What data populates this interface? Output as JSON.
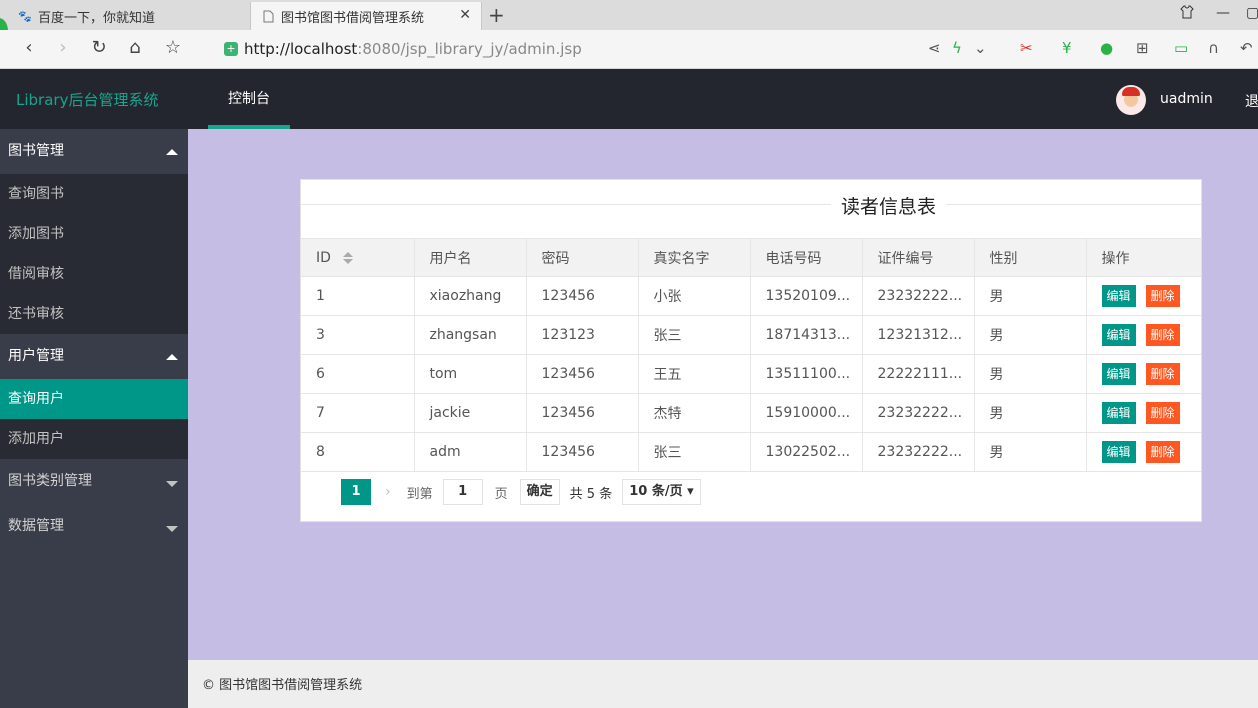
{
  "browser": {
    "tabs": [
      {
        "title": "百度一下，你就知道",
        "icon": "baidu-paw-icon"
      },
      {
        "title": "图书馆图书借阅管理系统",
        "icon": "page-icon"
      }
    ],
    "url_host": "http://localhost",
    "url_rest": ":8080/jsp_library_jy/admin.jsp"
  },
  "header": {
    "logo": "Library后台管理系统",
    "nav_console": "控制台",
    "username": "uadmin",
    "logout": "退"
  },
  "sidebar": {
    "book_group": "图书管理",
    "book_items": [
      "查询图书",
      "添加图书",
      "借阅审核",
      "还书审核"
    ],
    "user_group": "用户管理",
    "user_items": [
      "查询用户",
      "添加用户"
    ],
    "category_group": "图书类别管理",
    "data_group": "数据管理"
  },
  "panel": {
    "title": "读者信息表",
    "columns": [
      "ID",
      "用户名",
      "密码",
      "真实名字",
      "电话号码",
      "证件编号",
      "性别",
      "操作"
    ],
    "edit_label": "编辑",
    "delete_label": "删除",
    "rows": [
      [
        "1",
        "xiaozhang",
        "123456",
        "小张",
        "13520109...",
        "23232222...",
        "男"
      ],
      [
        "3",
        "zhangsan",
        "123123",
        "张三",
        "18714313...",
        "12321312...",
        "男"
      ],
      [
        "6",
        "tom",
        "123456",
        "王五",
        "13511100...",
        "22222111...",
        "男"
      ],
      [
        "7",
        "jackie",
        "123456",
        "杰特",
        "15910000...",
        "23232222...",
        "男"
      ],
      [
        "8",
        "adm",
        "123456",
        "张三",
        "13022502...",
        "23232222...",
        "男"
      ]
    ]
  },
  "pager": {
    "current": "1",
    "goto_label": "到第",
    "goto_value": "1",
    "page_label": "页",
    "ok": "确定",
    "total": "共 5 条",
    "page_size": "10 条/页"
  },
  "footer": "© 图书馆图书借阅管理系统"
}
